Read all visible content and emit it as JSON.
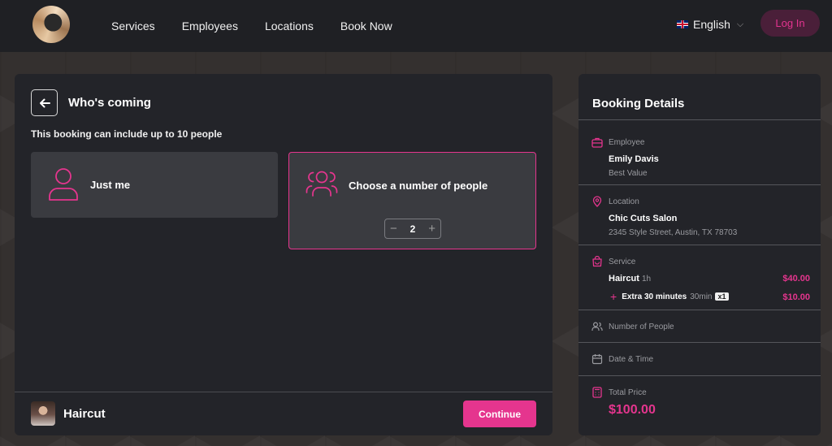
{
  "header": {
    "nav": [
      "Services",
      "Employees",
      "Locations",
      "Book Now"
    ],
    "language": "English",
    "login_label": "Log In"
  },
  "booking": {
    "title": "Who's coming",
    "subtitle": "This booking can include up to 10 people",
    "option_single": "Just me",
    "option_group": "Choose a number of people",
    "people_count": "2",
    "stepper_minus": "−",
    "stepper_plus": "+",
    "footer_service": "Haircut",
    "continue_label": "Continue"
  },
  "details": {
    "title": "Booking Details",
    "employee_heading": "Employee",
    "employee_name": "Emily Davis",
    "employee_note": "Best Value",
    "location_heading": "Location",
    "location_name": "Chic Cuts Salon",
    "location_address": "2345 Style Street, Austin, TX 78703",
    "service_heading": "Service",
    "service_name": "Haircut",
    "service_duration": "1h",
    "service_price": "$40.00",
    "extra_name": "Extra 30 minutes",
    "extra_duration": "30min",
    "extra_qty": "x1",
    "extra_price": "$10.00",
    "people_heading": "Number of People",
    "datetime_heading": "Date & Time",
    "total_heading": "Total Price",
    "total_value": "$100.00"
  },
  "colors": {
    "accent": "#e5358e",
    "panel": "#232429",
    "header": "#1f2024",
    "option_bg": "#3a3b40"
  },
  "icons": [
    "logo-icon",
    "flag-uk-icon",
    "chevron-down-icon",
    "arrow-left-icon",
    "user-icon",
    "users-icon",
    "minus-icon",
    "plus-icon",
    "briefcase-icon",
    "map-pin-icon",
    "shopping-bag-icon",
    "people-icon",
    "calendar-icon",
    "calculator-icon"
  ]
}
